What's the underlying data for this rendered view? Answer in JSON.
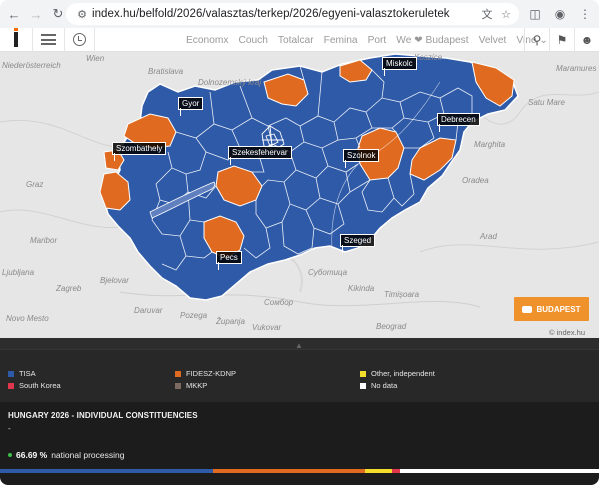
{
  "browser": {
    "url": "index.hu/belfold/2026/valasztas/terkep/2026/egyeni-valasztokeruletek",
    "icons": [
      "back-icon",
      "forward-icon",
      "reload-icon",
      "translate-icon",
      "star-icon",
      "extensions-icon",
      "profile-icon",
      "more-icon"
    ]
  },
  "site": {
    "nav": [
      "Economx",
      "Couch",
      "Totalcar",
      "Femina",
      "Port",
      "We ❤ Budapest",
      "Velvet",
      "Vine"
    ],
    "nav_more_icon": "chevron-down-icon"
  },
  "map": {
    "cities": [
      "Gyor",
      "Miskolc",
      "Debrecen",
      "Szombathely",
      "Szekesfehervar",
      "Szolnok",
      "Szeged",
      "Pecs"
    ],
    "background_places": [
      "Wien",
      "Bratislava",
      "Niederösterreich",
      "Dolnozemský kraj",
      "Koszice",
      "Satu Mare",
      "Maramures",
      "Marghita",
      "Oradea",
      "Graz",
      "Maribor",
      "Kikinda",
      "Timișoara",
      "Zagreb",
      "Суботица",
      "Сомбор",
      "Vukovar",
      "Bjelovar",
      "Pozega",
      "Županja",
      "Daruvar",
      "Ljubljana",
      "Novo Mesto",
      "Beograd",
      "Arad"
    ],
    "budapest_button": "BUDAPEST",
    "attribution": "© index.hu",
    "colors": {
      "tisa": "#2e5aa8",
      "fidesz": "#e06a1f",
      "border": "#ffffff",
      "base_map": "#e6e6e6"
    }
  },
  "legend": [
    {
      "label": "TISA",
      "color": "#2e5aa8"
    },
    {
      "label": "FIDESZ-KDNP",
      "color": "#e06a1f"
    },
    {
      "label": "Other, independent",
      "color": "#f2dd2a"
    },
    {
      "label": "South Korea",
      "color": "#e0364b"
    },
    {
      "label": "MKKP",
      "color": "#7a6a60"
    },
    {
      "label": "No data",
      "color": "#ffffff"
    }
  ],
  "results": {
    "title": "HUNGARY 2026 - INDIVIDUAL CONSTITUENCIES",
    "subtitle": "-",
    "processing_pct": "66.69 %",
    "processing_label": "national processing",
    "bar_segments": [
      {
        "party": "TISA",
        "share": 0.355,
        "color": "#2e5aa8"
      },
      {
        "party": "FIDESZ-KDNP",
        "share": 0.255,
        "color": "#e06a1f"
      },
      {
        "party": "Other, independent",
        "share": 0.045,
        "color": "#f2dd2a"
      },
      {
        "party": "South Korea",
        "share": 0.012,
        "color": "#e0364b"
      },
      {
        "party": "No data",
        "share": 0.333,
        "color": "#ffffff"
      }
    ]
  }
}
